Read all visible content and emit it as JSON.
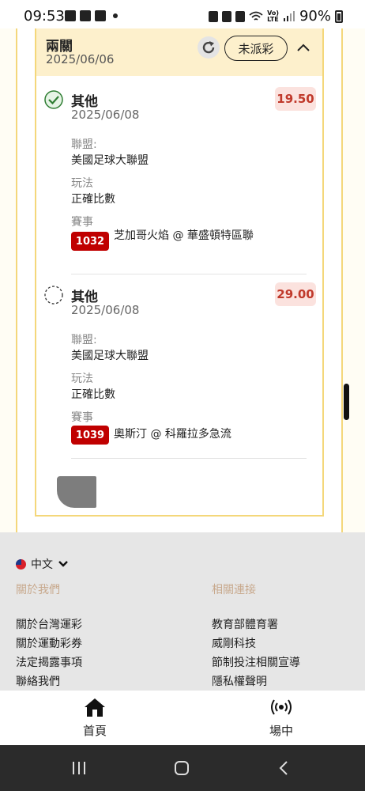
{
  "status_bar": {
    "time": "09:53",
    "battery": "90%",
    "lte_top": "Vo)",
    "lte_bottom": "LTE"
  },
  "slip": {
    "title": "兩關",
    "date": "2025/06/06",
    "status": "未派彩",
    "bets": [
      {
        "category": "其他",
        "date": "2025/06/08",
        "odds": "19.50",
        "checked": true,
        "league_label": "聯盟:",
        "league": "美國足球大聯盟",
        "play_label": "玩法",
        "play": "正確比數",
        "event_label": "賽事",
        "event_id": "1032",
        "event_name": "芝加哥火焰 @ 華盛頓特區聯"
      },
      {
        "category": "其他",
        "date": "2025/06/08",
        "odds": "29.00",
        "checked": false,
        "league_label": "聯盟:",
        "league": "美國足球大聯盟",
        "play_label": "玩法",
        "play": "正確比數",
        "event_label": "賽事",
        "event_id": "1039",
        "event_name": "奧斯汀 @ 科羅拉多急流"
      }
    ]
  },
  "footer": {
    "language": "中文",
    "about_heading": "關於我們",
    "links_heading": "相關連接",
    "about_links": [
      "關於台灣運彩",
      "關於運動彩券",
      "法定揭露事項",
      "聯絡我們"
    ],
    "related_links": [
      "教育部體育署",
      "威剛科技",
      "節制投注相關宣導",
      "隱私權聲明"
    ]
  },
  "bottom_nav": {
    "home": "首頁",
    "live": "場中"
  },
  "colors": {
    "accent_yellow": "#f4d77a",
    "header_bg": "#fdf0cc",
    "badge_red": "#c00000",
    "odds_red": "#c0392b",
    "check_green": "#2e7d32"
  }
}
